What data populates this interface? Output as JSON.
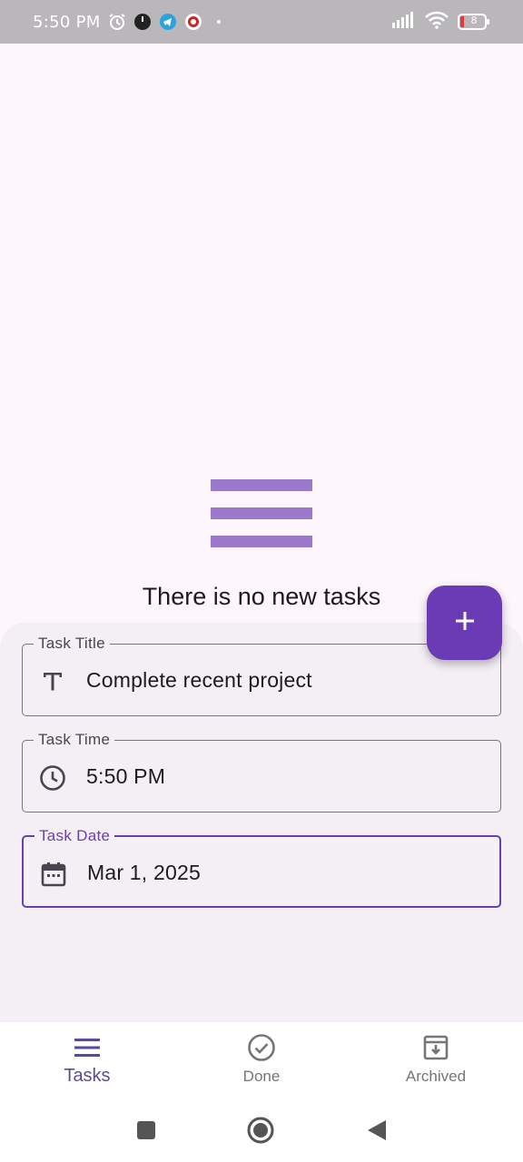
{
  "status_bar": {
    "time": "5:50 PM",
    "battery": "8",
    "icons": [
      "alarm-icon",
      "clock-app-icon",
      "telegram-icon",
      "vpn-icon",
      "signal-icon",
      "wifi-icon",
      "battery-icon"
    ]
  },
  "empty_state": {
    "icon": "menu-lines-icon",
    "message": "There is no new tasks"
  },
  "form": {
    "title_field": {
      "label": "Task Title",
      "value": "Complete recent project",
      "icon": "text-title-icon"
    },
    "time_field": {
      "label": "Task Time",
      "value": "5:50 PM",
      "icon": "clock-icon"
    },
    "date_field": {
      "label": "Task Date",
      "value": "Mar 1, 2025",
      "icon": "calendar-icon"
    }
  },
  "fab": {
    "icon": "plus-icon"
  },
  "bottom_nav": {
    "items": [
      {
        "label": "Tasks",
        "icon": "menu-icon",
        "active": true
      },
      {
        "label": "Done",
        "icon": "check-circle-icon",
        "active": false
      },
      {
        "label": "Archived",
        "icon": "archive-icon",
        "active": false
      }
    ]
  },
  "system_nav": [
    "recents-button",
    "home-button",
    "back-button"
  ],
  "colors": {
    "accent": "#6a3bb5",
    "empty_icon": "#9b7acb",
    "background": "#fdf6fd",
    "sheet": "#f4eff4"
  }
}
